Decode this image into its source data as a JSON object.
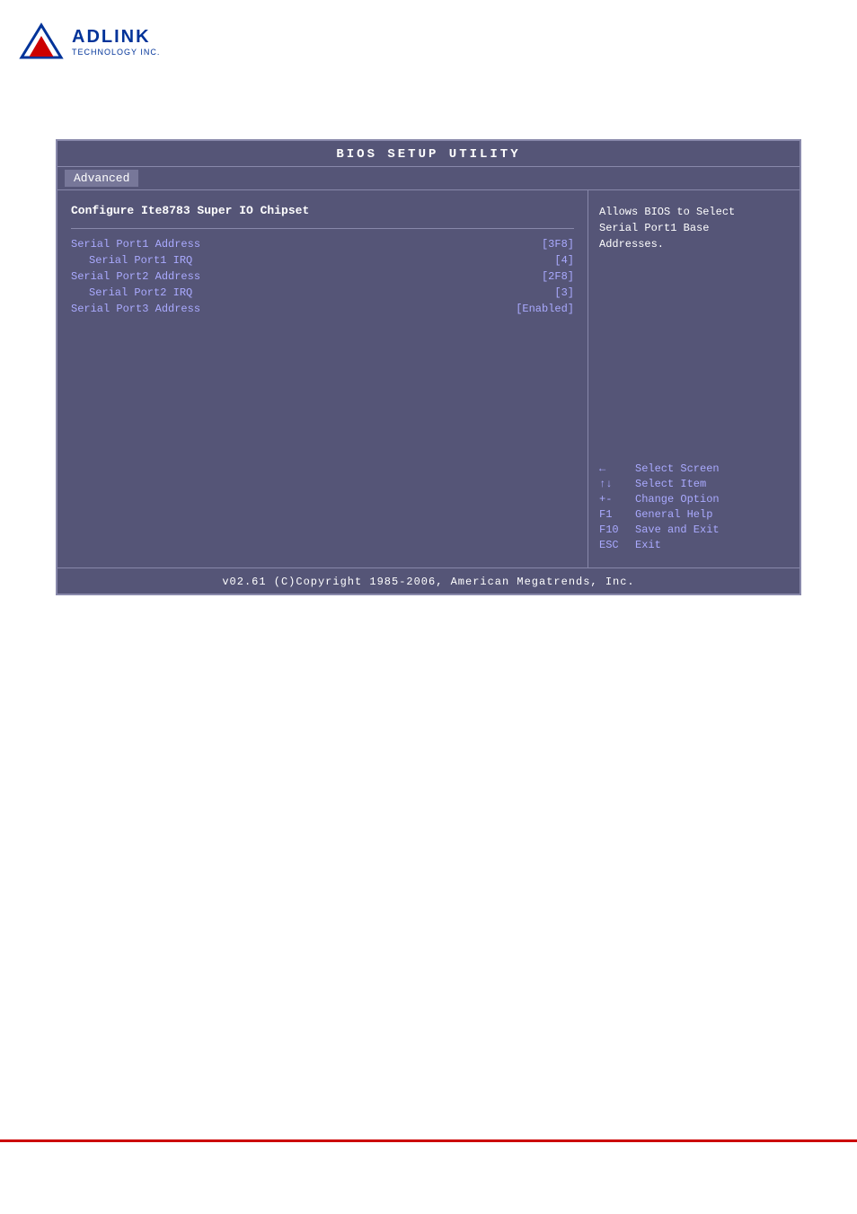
{
  "logo": {
    "adlink_text": "ADLINK",
    "subtitle_text": "TECHNOLOGY INC."
  },
  "bios": {
    "title": "BIOS  SETUP  UTILITY",
    "tab": "Advanced",
    "section_title": "Configure Ite8783 Super IO Chipset",
    "items": [
      {
        "label": "Serial Port1 Address",
        "value": "[3F8]",
        "indented": false
      },
      {
        "label": "Serial Port1 IRQ",
        "value": "[4]",
        "indented": true
      },
      {
        "label": "Serial Port2 Address",
        "value": "[2F8]",
        "indented": false
      },
      {
        "label": "Serial Port2 IRQ",
        "value": "[3]",
        "indented": true
      },
      {
        "label": "Serial Port3 Address",
        "value": "[Enabled]",
        "indented": false
      }
    ],
    "help_text": "Allows BIOS to Select\nSerial Port1 Base\nAddresses.",
    "keybindings": [
      {
        "key": "←",
        "desc": "Select Screen"
      },
      {
        "key": "↑↓",
        "desc": "Select Item"
      },
      {
        "key": "+-",
        "desc": "Change Option"
      },
      {
        "key": "F1",
        "desc": "General Help"
      },
      {
        "key": "F10",
        "desc": "Save and Exit"
      },
      {
        "key": "ESC",
        "desc": "Exit"
      }
    ],
    "footer": "v02.61  (C)Copyright 1985-2006, American Megatrends, Inc."
  }
}
